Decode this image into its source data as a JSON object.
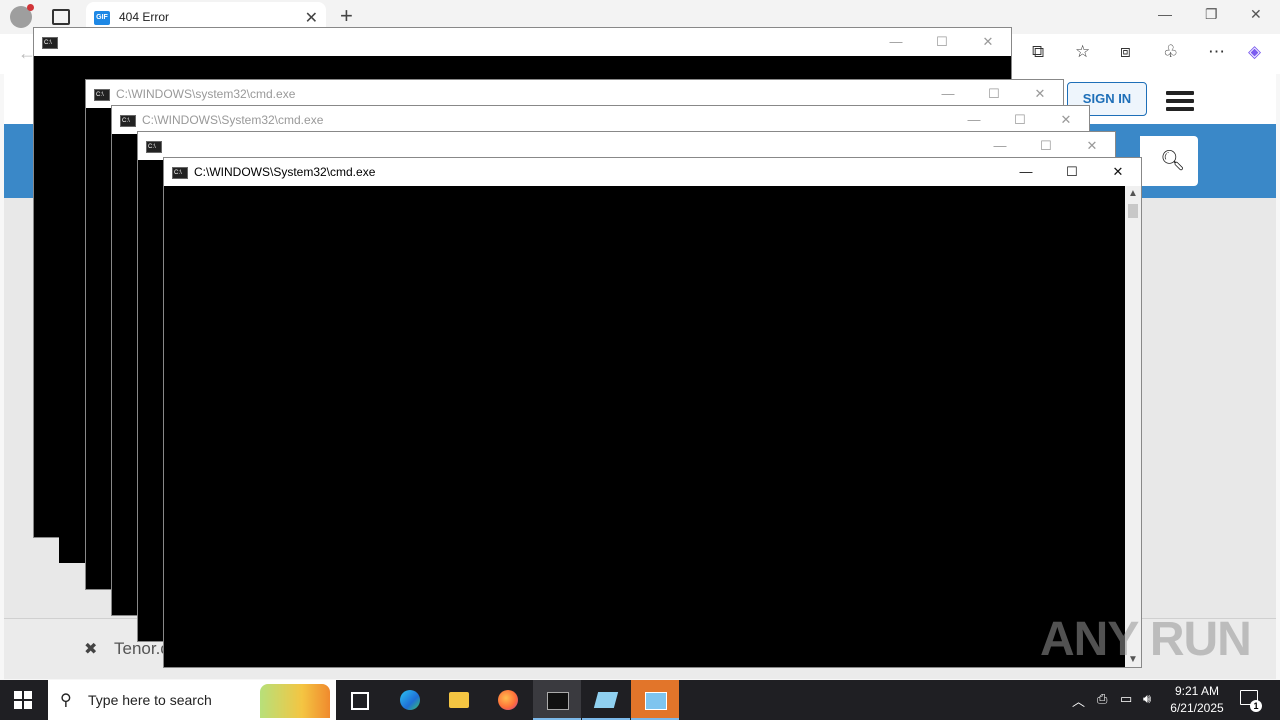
{
  "browser": {
    "tab_title": "404 Error",
    "tab_favicon": "GIF",
    "site": {
      "signin_label": "SIGN IN",
      "cookie_text": "Tenor.c"
    }
  },
  "windows": [
    {
      "title": ""
    },
    {
      "title": "C:\\WINDOWS\\system32\\cmd.exe"
    },
    {
      "title": "C:\\WINDOWS\\System32\\cmd.exe"
    },
    {
      "title": ""
    },
    {
      "title": "C:\\WINDOWS\\System32\\cmd.exe"
    }
  ],
  "watermark": "ANY RUN",
  "taskbar": {
    "search_placeholder": "Type here to search",
    "time": "9:21 AM",
    "date": "6/21/2025",
    "notifications": "1"
  },
  "colors": {
    "taskbar": "#1f1f23",
    "site_blue": "#3a88c8",
    "signin": "#1e6fb8"
  }
}
